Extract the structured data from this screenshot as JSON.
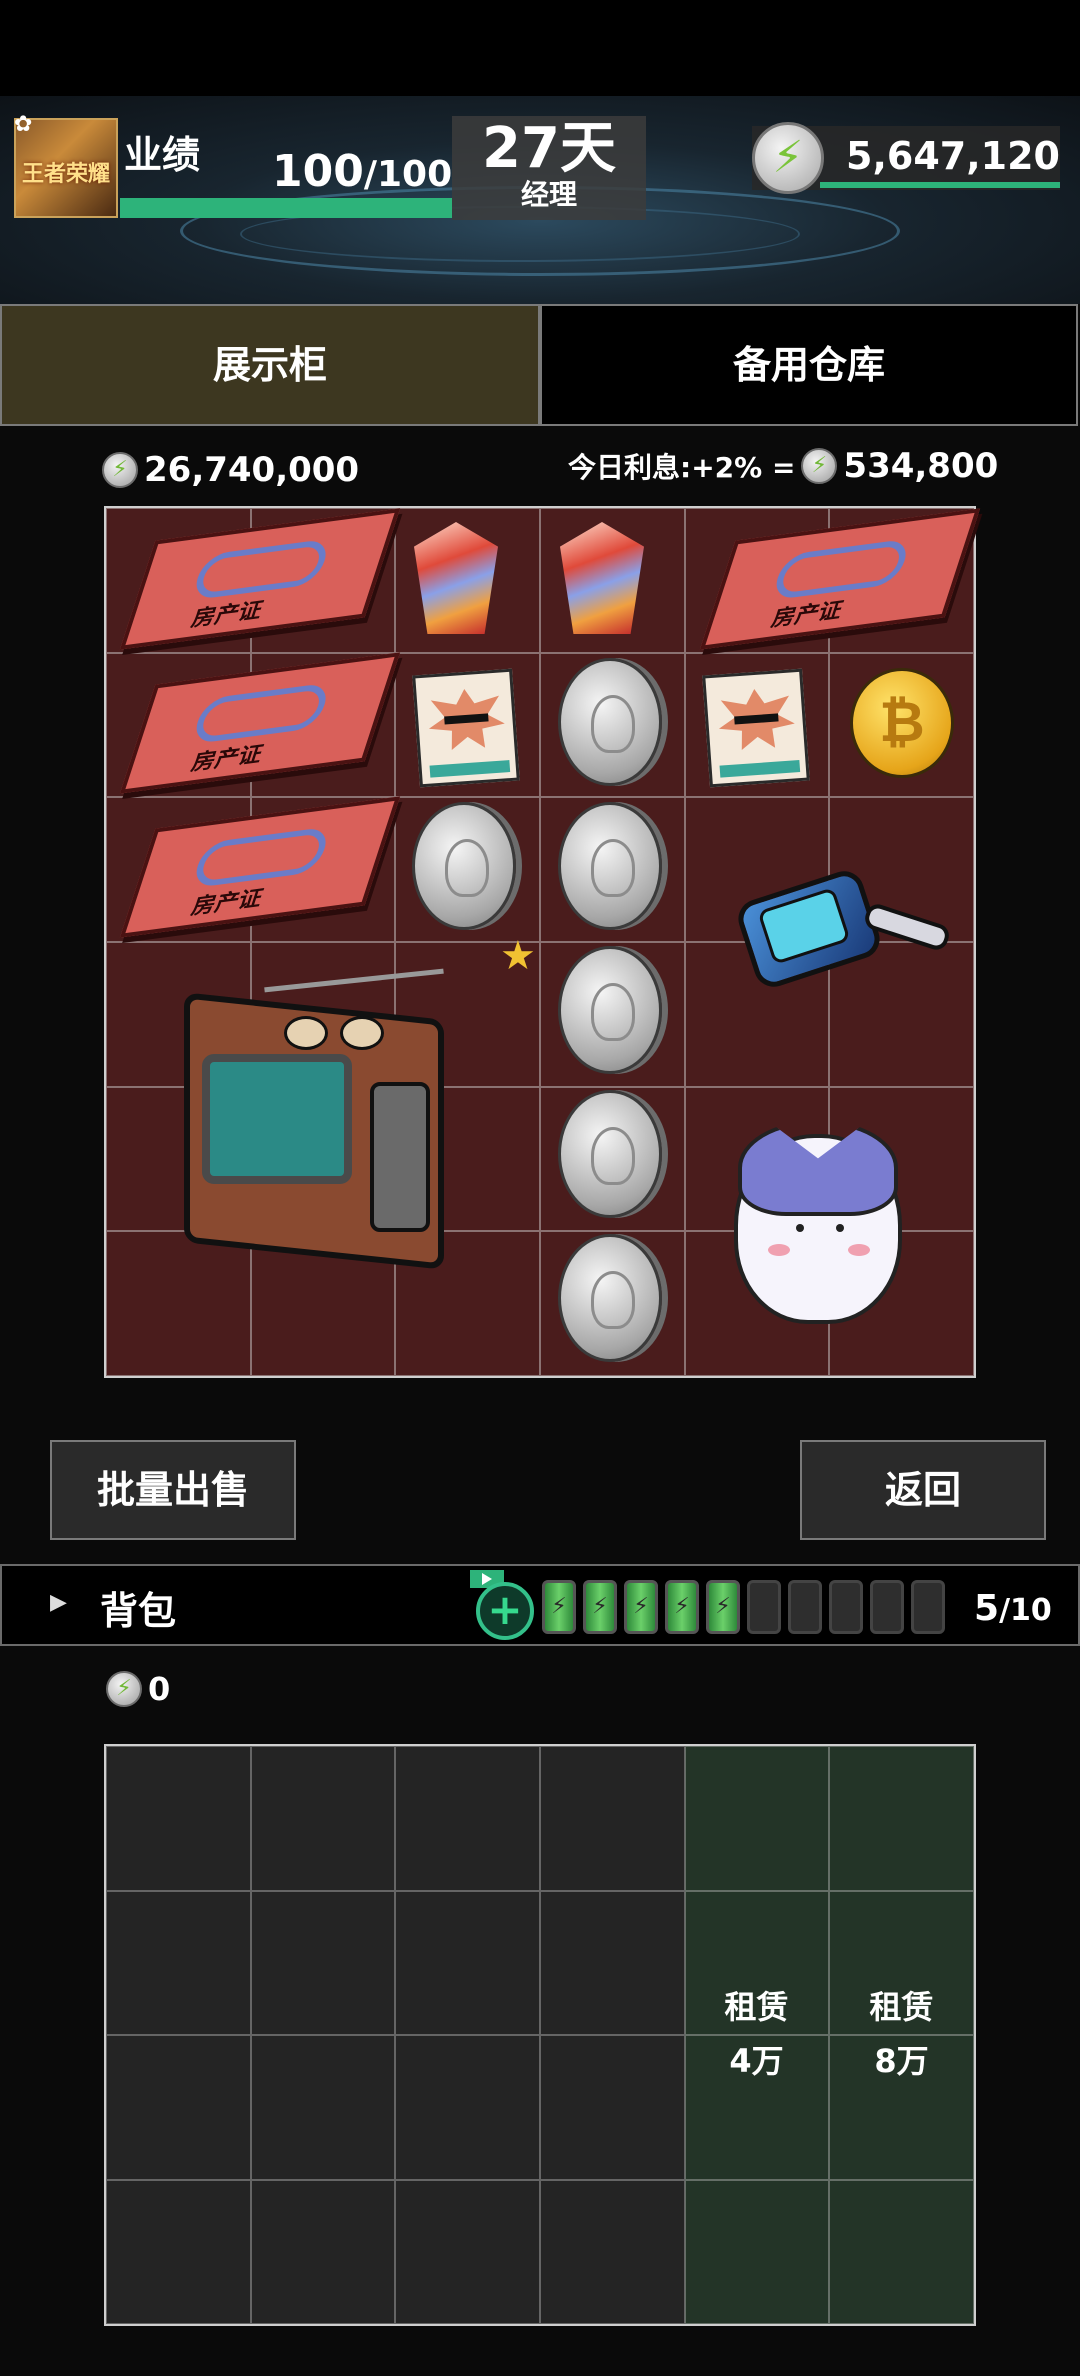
{
  "hud": {
    "logo_text": "王者荣耀",
    "performance_label": "业绩",
    "performance_current": "100",
    "performance_max": "/100",
    "performance_fraction": 1.0,
    "days": "27天",
    "rank": "经理",
    "coins": "5,647,120",
    "icon_energy": "⚡",
    "icon_settings": "✿"
  },
  "tabs": {
    "showcase": "展示柜",
    "warehouse": "备用仓库"
  },
  "showcase": {
    "total_value": "26,740,000",
    "interest_label": "今日利息:+2% =",
    "interest_value": "534,800",
    "items": {
      "deed_text": "房产证",
      "btc_symbol": "₿",
      "star": "★"
    }
  },
  "buttons": {
    "bulk_sell": "批量出售",
    "back": "返回"
  },
  "backpack": {
    "expand_icon": "▶",
    "title": "背包",
    "add_icon": "+",
    "filled_slots": 5,
    "total_slots": 10,
    "count_current": "5",
    "count_total": "/10",
    "money": "0",
    "rent": [
      {
        "label": "租赁",
        "price": "4万"
      },
      {
        "label": "租赁",
        "price": "8万"
      }
    ]
  },
  "colors": {
    "accent_green": "#2db37a",
    "showcase_bg": "#4a1c1c",
    "selected_tab": "#3d3720",
    "gold_star": "#f1c232"
  }
}
